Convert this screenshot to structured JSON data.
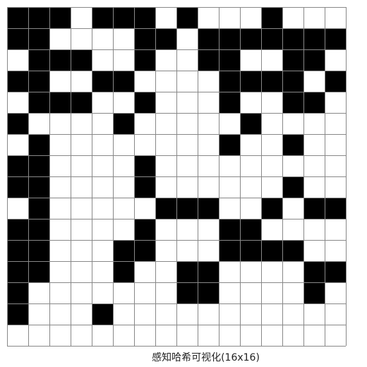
{
  "caption": "感知哈希可视化(16x16)",
  "grid": {
    "rows": 16,
    "cols": 16,
    "cells": [
      "1110111010001000",
      "1100001101111111",
      "0111001001100110",
      "1100110000111101",
      "0111001000100110",
      "1000010000010000",
      "0100000000100100",
      "1100001000000000",
      "1100001000000100",
      "0100000111001011",
      "1100001000110000",
      "1100011000111100",
      "1100010011000011",
      "1000000011000010",
      "1000100000000000",
      "0000000000000000"
    ],
    "colors": {
      "on": "#000000",
      "off": "#ffffff",
      "line": "#888888"
    }
  }
}
